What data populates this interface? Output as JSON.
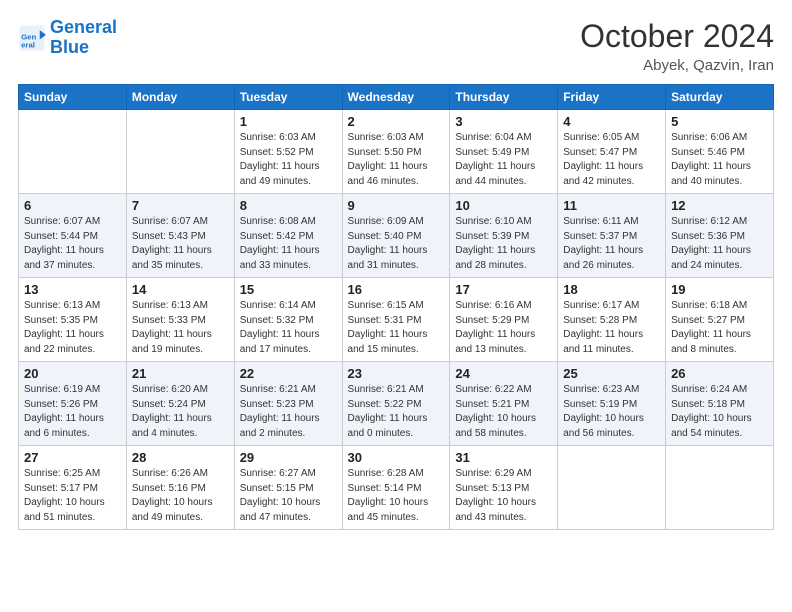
{
  "header": {
    "logo_line1": "General",
    "logo_line2": "Blue",
    "month": "October 2024",
    "location": "Abyek, Qazvin, Iran"
  },
  "weekdays": [
    "Sunday",
    "Monday",
    "Tuesday",
    "Wednesday",
    "Thursday",
    "Friday",
    "Saturday"
  ],
  "weeks": [
    [
      null,
      null,
      {
        "day": "1",
        "sunrise": "Sunrise: 6:03 AM",
        "sunset": "Sunset: 5:52 PM",
        "daylight": "Daylight: 11 hours and 49 minutes."
      },
      {
        "day": "2",
        "sunrise": "Sunrise: 6:03 AM",
        "sunset": "Sunset: 5:50 PM",
        "daylight": "Daylight: 11 hours and 46 minutes."
      },
      {
        "day": "3",
        "sunrise": "Sunrise: 6:04 AM",
        "sunset": "Sunset: 5:49 PM",
        "daylight": "Daylight: 11 hours and 44 minutes."
      },
      {
        "day": "4",
        "sunrise": "Sunrise: 6:05 AM",
        "sunset": "Sunset: 5:47 PM",
        "daylight": "Daylight: 11 hours and 42 minutes."
      },
      {
        "day": "5",
        "sunrise": "Sunrise: 6:06 AM",
        "sunset": "Sunset: 5:46 PM",
        "daylight": "Daylight: 11 hours and 40 minutes."
      }
    ],
    [
      {
        "day": "6",
        "sunrise": "Sunrise: 6:07 AM",
        "sunset": "Sunset: 5:44 PM",
        "daylight": "Daylight: 11 hours and 37 minutes."
      },
      {
        "day": "7",
        "sunrise": "Sunrise: 6:07 AM",
        "sunset": "Sunset: 5:43 PM",
        "daylight": "Daylight: 11 hours and 35 minutes."
      },
      {
        "day": "8",
        "sunrise": "Sunrise: 6:08 AM",
        "sunset": "Sunset: 5:42 PM",
        "daylight": "Daylight: 11 hours and 33 minutes."
      },
      {
        "day": "9",
        "sunrise": "Sunrise: 6:09 AM",
        "sunset": "Sunset: 5:40 PM",
        "daylight": "Daylight: 11 hours and 31 minutes."
      },
      {
        "day": "10",
        "sunrise": "Sunrise: 6:10 AM",
        "sunset": "Sunset: 5:39 PM",
        "daylight": "Daylight: 11 hours and 28 minutes."
      },
      {
        "day": "11",
        "sunrise": "Sunrise: 6:11 AM",
        "sunset": "Sunset: 5:37 PM",
        "daylight": "Daylight: 11 hours and 26 minutes."
      },
      {
        "day": "12",
        "sunrise": "Sunrise: 6:12 AM",
        "sunset": "Sunset: 5:36 PM",
        "daylight": "Daylight: 11 hours and 24 minutes."
      }
    ],
    [
      {
        "day": "13",
        "sunrise": "Sunrise: 6:13 AM",
        "sunset": "Sunset: 5:35 PM",
        "daylight": "Daylight: 11 hours and 22 minutes."
      },
      {
        "day": "14",
        "sunrise": "Sunrise: 6:13 AM",
        "sunset": "Sunset: 5:33 PM",
        "daylight": "Daylight: 11 hours and 19 minutes."
      },
      {
        "day": "15",
        "sunrise": "Sunrise: 6:14 AM",
        "sunset": "Sunset: 5:32 PM",
        "daylight": "Daylight: 11 hours and 17 minutes."
      },
      {
        "day": "16",
        "sunrise": "Sunrise: 6:15 AM",
        "sunset": "Sunset: 5:31 PM",
        "daylight": "Daylight: 11 hours and 15 minutes."
      },
      {
        "day": "17",
        "sunrise": "Sunrise: 6:16 AM",
        "sunset": "Sunset: 5:29 PM",
        "daylight": "Daylight: 11 hours and 13 minutes."
      },
      {
        "day": "18",
        "sunrise": "Sunrise: 6:17 AM",
        "sunset": "Sunset: 5:28 PM",
        "daylight": "Daylight: 11 hours and 11 minutes."
      },
      {
        "day": "19",
        "sunrise": "Sunrise: 6:18 AM",
        "sunset": "Sunset: 5:27 PM",
        "daylight": "Daylight: 11 hours and 8 minutes."
      }
    ],
    [
      {
        "day": "20",
        "sunrise": "Sunrise: 6:19 AM",
        "sunset": "Sunset: 5:26 PM",
        "daylight": "Daylight: 11 hours and 6 minutes."
      },
      {
        "day": "21",
        "sunrise": "Sunrise: 6:20 AM",
        "sunset": "Sunset: 5:24 PM",
        "daylight": "Daylight: 11 hours and 4 minutes."
      },
      {
        "day": "22",
        "sunrise": "Sunrise: 6:21 AM",
        "sunset": "Sunset: 5:23 PM",
        "daylight": "Daylight: 11 hours and 2 minutes."
      },
      {
        "day": "23",
        "sunrise": "Sunrise: 6:21 AM",
        "sunset": "Sunset: 5:22 PM",
        "daylight": "Daylight: 11 hours and 0 minutes."
      },
      {
        "day": "24",
        "sunrise": "Sunrise: 6:22 AM",
        "sunset": "Sunset: 5:21 PM",
        "daylight": "Daylight: 10 hours and 58 minutes."
      },
      {
        "day": "25",
        "sunrise": "Sunrise: 6:23 AM",
        "sunset": "Sunset: 5:19 PM",
        "daylight": "Daylight: 10 hours and 56 minutes."
      },
      {
        "day": "26",
        "sunrise": "Sunrise: 6:24 AM",
        "sunset": "Sunset: 5:18 PM",
        "daylight": "Daylight: 10 hours and 54 minutes."
      }
    ],
    [
      {
        "day": "27",
        "sunrise": "Sunrise: 6:25 AM",
        "sunset": "Sunset: 5:17 PM",
        "daylight": "Daylight: 10 hours and 51 minutes."
      },
      {
        "day": "28",
        "sunrise": "Sunrise: 6:26 AM",
        "sunset": "Sunset: 5:16 PM",
        "daylight": "Daylight: 10 hours and 49 minutes."
      },
      {
        "day": "29",
        "sunrise": "Sunrise: 6:27 AM",
        "sunset": "Sunset: 5:15 PM",
        "daylight": "Daylight: 10 hours and 47 minutes."
      },
      {
        "day": "30",
        "sunrise": "Sunrise: 6:28 AM",
        "sunset": "Sunset: 5:14 PM",
        "daylight": "Daylight: 10 hours and 45 minutes."
      },
      {
        "day": "31",
        "sunrise": "Sunrise: 6:29 AM",
        "sunset": "Sunset: 5:13 PM",
        "daylight": "Daylight: 10 hours and 43 minutes."
      },
      null,
      null
    ]
  ]
}
